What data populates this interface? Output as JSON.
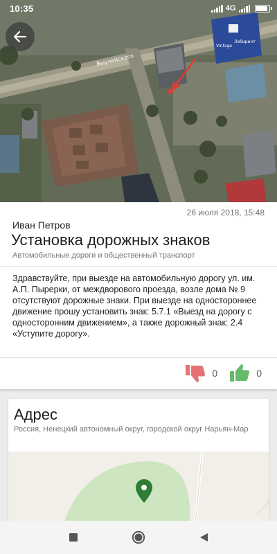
{
  "status_bar": {
    "time": "10:35",
    "network": "4G",
    "battery_level": 0.85
  },
  "header": {
    "back_icon": "arrow-left-icon",
    "map_label_street": "Выучейского",
    "map_label_business": "Лабиринт",
    "map_label_vintage": "Vintage"
  },
  "incident": {
    "date": "26 июля 2018, 15:48",
    "author": "Иван Петров",
    "title": "Установка дорожных знаков",
    "category": "Автомобильные дороги и общественный транспорт",
    "body": "Здравствуйте, при выезде на автомобильную дорогу ул. им. А.П. Пырерки, от междворового проезда, возле дома № 9 отсутствуют дорожные знаки. При выезде на одностороннее движение прошу установить знак: 5.7.1 «Выезд на дорогу с односторонним движением», а также дорожный знак: 2.4 «Уступите дорогу».",
    "dislikes": "0",
    "likes": "0",
    "dislike_color": "#e57373",
    "like_color": "#66bb6a"
  },
  "address": {
    "title": "Адрес",
    "text": "Россия, Ненецкий автономный округ, городской округ Нарьян-Мар",
    "pin_color": "#2e7d32"
  },
  "nav": {
    "recent_icon": "square-icon",
    "home_icon": "circle-icon",
    "back_icon": "triangle-back-icon"
  }
}
